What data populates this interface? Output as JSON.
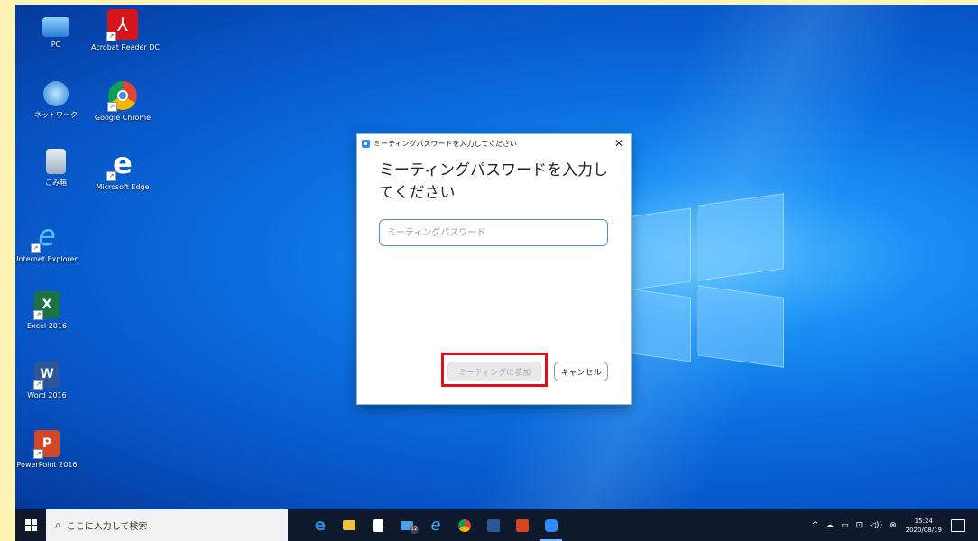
{
  "desktop_icons": [
    {
      "id": "pc",
      "label": "PC",
      "icon": "pc-icon",
      "color": "#4aa3e8"
    },
    {
      "id": "acrobat",
      "label": "Acrobat Reader DC",
      "icon": "acrobat-icon",
      "color": "#d7151a"
    },
    {
      "id": "network",
      "label": "ネットワーク",
      "icon": "network-icon",
      "color": "#3c9de0"
    },
    {
      "id": "chrome",
      "label": "Google Chrome",
      "icon": "chrome-icon",
      "color": "#e8453c"
    },
    {
      "id": "recycle",
      "label": "ごみ箱",
      "icon": "recycle-bin-icon",
      "color": "#cfd8e0"
    },
    {
      "id": "edge",
      "label": "Microsoft Edge",
      "icon": "edge-icon",
      "color": "#1a7fd6"
    },
    {
      "id": "ie",
      "label": "Internet Explorer",
      "icon": "ie-icon",
      "color": "#1ea0f0"
    },
    {
      "id": "excel",
      "label": "Excel 2016",
      "icon": "excel-icon",
      "color": "#1e7145"
    },
    {
      "id": "word",
      "label": "Word 2016",
      "icon": "word-icon",
      "color": "#2b579a"
    },
    {
      "id": "powerpoint",
      "label": "PowerPoint 2016",
      "icon": "powerpoint-icon",
      "color": "#d24726"
    }
  ],
  "dialog": {
    "title": "ミーティングパスワードを入力してください",
    "heading": "ミーティングパスワードを入力してください",
    "password_placeholder": "ミーティングパスワード",
    "join_label": "ミーティングに参加",
    "cancel_label": "キャンセル",
    "close_glyph": "✕"
  },
  "taskbar": {
    "search_placeholder": "ここに入力して検索",
    "pinned": [
      {
        "id": "edge",
        "icon": "edge-icon",
        "color": "#2a8ad8"
      },
      {
        "id": "explorer",
        "icon": "file-explorer-icon",
        "color": "#f0c040"
      },
      {
        "id": "store",
        "icon": "store-icon",
        "color": "#ffffff"
      },
      {
        "id": "mail",
        "icon": "mail-icon",
        "color": "#4fa0e8",
        "badge": "12"
      },
      {
        "id": "ie",
        "icon": "ie-icon",
        "color": "#3aa8f0"
      },
      {
        "id": "chrome",
        "icon": "chrome-icon",
        "color": "#f4b400"
      },
      {
        "id": "word",
        "icon": "word-icon",
        "color": "#2b579a"
      },
      {
        "id": "powerpoint",
        "icon": "powerpoint-icon",
        "color": "#d24726"
      },
      {
        "id": "zoom",
        "icon": "zoom-icon",
        "color": "#2d8cff",
        "active": true
      }
    ],
    "tray_glyphs": [
      "^",
      "☁",
      "▭",
      "⊡",
      "◁))",
      "⊗"
    ],
    "time": "15:24",
    "date": "2020/08/19"
  }
}
